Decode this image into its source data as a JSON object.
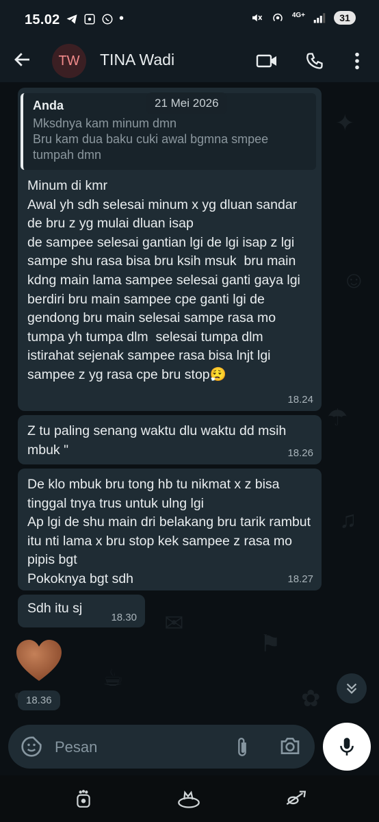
{
  "status_bar": {
    "time": "15.02",
    "network_label": "4G+",
    "battery": "31"
  },
  "header": {
    "avatar_initials": "TW",
    "contact_name": "TINA Wadi"
  },
  "date_chip": "21 Mei 2026",
  "messages": [
    {
      "quote_author": "Anda",
      "quote_text": "Mksdnya kam minum dmn\nBru kam dua baku cuki awal bgmna smpee tumpah dmn",
      "text": "Minum di kmr\nAwal yh sdh selesai minum x yg dluan sandar de bru z yg mulai dluan isap\nde sampee selesai gantian lgi de lgi isap z lgi sampe shu rasa bisa bru ksih msuk  bru main kdng main lama sampee selesai ganti gaya lgi berdiri bru main sampee cpe ganti lgi de gendong bru main selesai sampe rasa mo tumpa yh tumpa dlm  selesai tumpa dlm istirahat sejenak sampee rasa bisa lnjt lgi sampee z yg rasa cpe bru stop😮‍💨",
      "time": "18.24"
    },
    {
      "text": "Z tu paling senang waktu dlu waktu dd msih mbuk \"",
      "time": "18.26"
    },
    {
      "text": "De klo mbuk bru tong hb tu nikmat x z bisa tinggal tnya trus untuk ulng lgi\nAp lgi de shu main dri belakang bru tarik rambut  itu nti lama x bru stop kek sampee z rasa mo pipis bgt\nPokoknya bgt sdh",
      "time": "18.27"
    },
    {
      "text": "Sdh itu sj",
      "time": "18.30"
    }
  ],
  "heart_message": {
    "emoji": "🤎",
    "time": "18.36"
  },
  "composer": {
    "placeholder": "Pesan"
  },
  "colors": {
    "background": "#0b1014",
    "bubble": "#1f2c34",
    "header": "#121b22",
    "avatar_bg": "#3b1f23",
    "avatar_text": "#f28b8b"
  },
  "icons": [
    "back-arrow-icon",
    "video-call-icon",
    "phone-icon",
    "more-vert-icon",
    "emoji-sticker-icon",
    "attach-icon",
    "camera-icon",
    "mic-icon",
    "chevron-double-down-icon"
  ]
}
